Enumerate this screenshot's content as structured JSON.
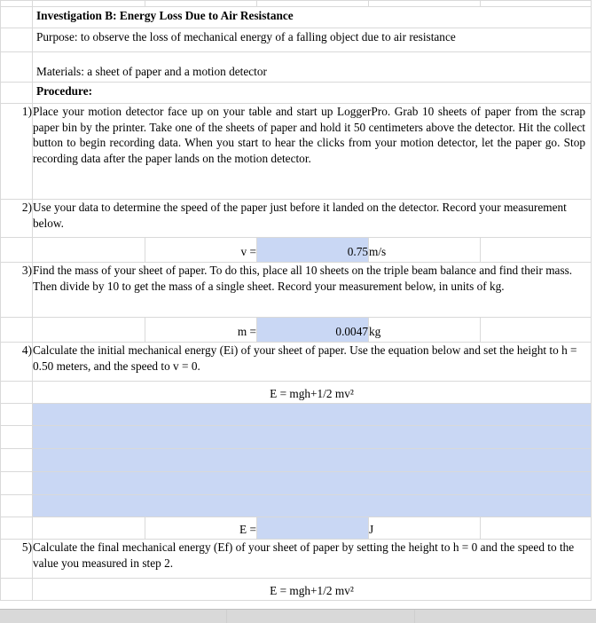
{
  "document": {
    "title": "Investigation B: Energy Loss Due to Air Resistance",
    "purpose": "Purpose: to observe the loss of mechanical energy of a falling object due to air resistance",
    "materials": "Materials: a sheet of paper and a motion detector",
    "procedure_heading": "Procedure:"
  },
  "colors": {
    "highlight_cell": "#c9d7f4",
    "gridline": "#d9d9d9",
    "scrollbar_track": "#d9d9d9",
    "text": "#000000"
  },
  "steps": [
    {
      "number": "1)",
      "text": "Place your motion detector face up on your table and start up LoggerPro. Grab 10 sheets of paper from the scrap paper bin by the printer. Take one of the sheets of paper and hold it 50 centimeters above the detector. Hit the collect button to begin recording data. When you start to hear the clicks from your motion detector, let the paper go. Stop recording data after the paper lands on the motion detector."
    },
    {
      "number": "2)",
      "text": "Use your data to determine the speed of the paper just before it landed on the detector. Record your measurement below."
    },
    {
      "number": "3)",
      "text": "Find the mass of your sheet of paper. To do this, place all 10 sheets on the triple beam balance and find their mass. Then divide by 10 to get the mass of a single sheet. Record your measurement below, in units of kg."
    },
    {
      "number": "4)",
      "text": "Calculate the initial mechanical energy (Ei) of your sheet of paper. Use the equation below and set the height to h = 0.50 meters, and the speed to v = 0."
    },
    {
      "number": "5)",
      "text": "Calculate the final mechanical energy (Ef) of your sheet of paper by setting the height to h = 0 and the speed to the value you measured in step 2."
    }
  ],
  "measurements": [
    {
      "label": "v =",
      "value": "0.75",
      "unit": "m/s"
    },
    {
      "label": "m =",
      "value": "0.0047",
      "unit": "kg"
    },
    {
      "label": "E =",
      "value": "",
      "unit": "J"
    }
  ],
  "equations": {
    "initial": "E = mgh+1/2 mv²",
    "final": "E = mgh+1/2 mv²"
  }
}
